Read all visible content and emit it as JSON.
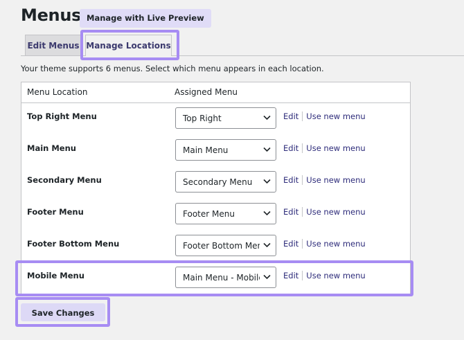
{
  "page": {
    "title": "Menus",
    "live_preview_label": "Manage with Live Preview",
    "intro": "Your theme supports 6 menus. Select which menu appears in each location."
  },
  "tabs": [
    {
      "label": "Edit Menus",
      "active": false
    },
    {
      "label": "Manage Locations",
      "active": true
    }
  ],
  "table": {
    "headers": {
      "location": "Menu Location",
      "assigned": "Assigned Menu"
    },
    "rows": [
      {
        "location": "Top Right Menu",
        "selected": "Top Right",
        "edit": "Edit",
        "new_menu": "Use new menu"
      },
      {
        "location": "Main Menu",
        "selected": "Main Menu",
        "edit": "Edit",
        "new_menu": "Use new menu"
      },
      {
        "location": "Secondary Menu",
        "selected": "Secondary Menu",
        "edit": "Edit",
        "new_menu": "Use new menu"
      },
      {
        "location": "Footer Menu",
        "selected": "Footer Menu",
        "edit": "Edit",
        "new_menu": "Use new menu"
      },
      {
        "location": "Footer Bottom Menu",
        "selected": "Footer Bottom Menu",
        "edit": "Edit",
        "new_menu": "Use new menu"
      },
      {
        "location": "Mobile Menu",
        "selected": "Main Menu - Mobile",
        "edit": "Edit",
        "new_menu": "Use new menu"
      }
    ]
  },
  "save_label": "Save Changes",
  "colors": {
    "highlight": "#a78cf3",
    "button_bg": "#ddd9f6",
    "link": "#2d2b7a"
  }
}
